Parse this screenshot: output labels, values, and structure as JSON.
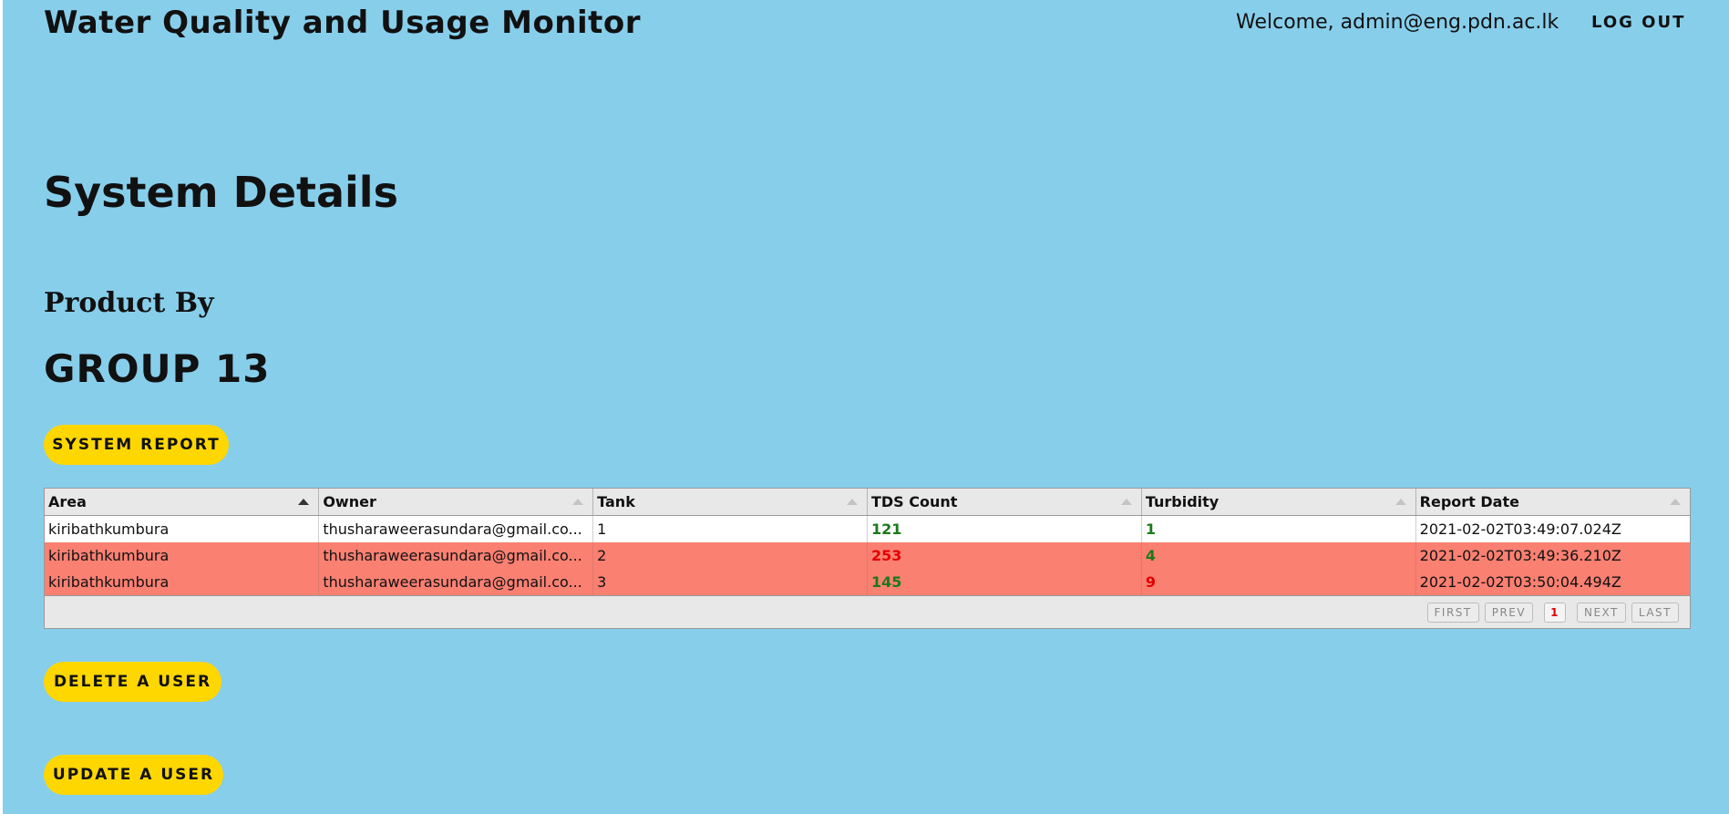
{
  "header": {
    "app_title": "Water Quality and Usage Monitor",
    "welcome_text": "Welcome, admin@eng.pdn.ac.lk",
    "logout_label": "LOG OUT"
  },
  "main": {
    "page_title": "System Details",
    "product_label": "Product By",
    "group_name": "GROUP 13",
    "system_report_label": "SYSTEM REPORT",
    "delete_user_label": "DELETE A USER",
    "update_user_label": "UPDATE A USER"
  },
  "table": {
    "columns": [
      "Area",
      "Owner",
      "Tank",
      "TDS Count",
      "Turbidity",
      "Report Date"
    ],
    "sorted_column": "Area",
    "rows": [
      {
        "area": "kiribathkumbura",
        "owner": "thusharaweerasundara@gmail.co...",
        "tank": "1",
        "tds": "121",
        "turbidity": "1",
        "report_date": "2021-02-02T03:49:07.024Z"
      },
      {
        "area": "kiribathkumbura",
        "owner": "thusharaweerasundara@gmail.co...",
        "tank": "2",
        "tds": "253",
        "turbidity": "4",
        "report_date": "2021-02-02T03:49:36.210Z"
      },
      {
        "area": "kiribathkumbura",
        "owner": "thusharaweerasundara@gmail.co...",
        "tank": "3",
        "tds": "145",
        "turbidity": "9",
        "report_date": "2021-02-02T03:50:04.494Z"
      }
    ]
  },
  "pager": {
    "first": "FIRST",
    "prev": "PREV",
    "current_page": "1",
    "next": "NEXT",
    "last": "LAST"
  },
  "colors": {
    "background": "#87CEEB",
    "button": "#FFD700",
    "alert_row": "#FA8072",
    "value_ok": "#1a7a1a",
    "value_bad": "#e10000"
  }
}
